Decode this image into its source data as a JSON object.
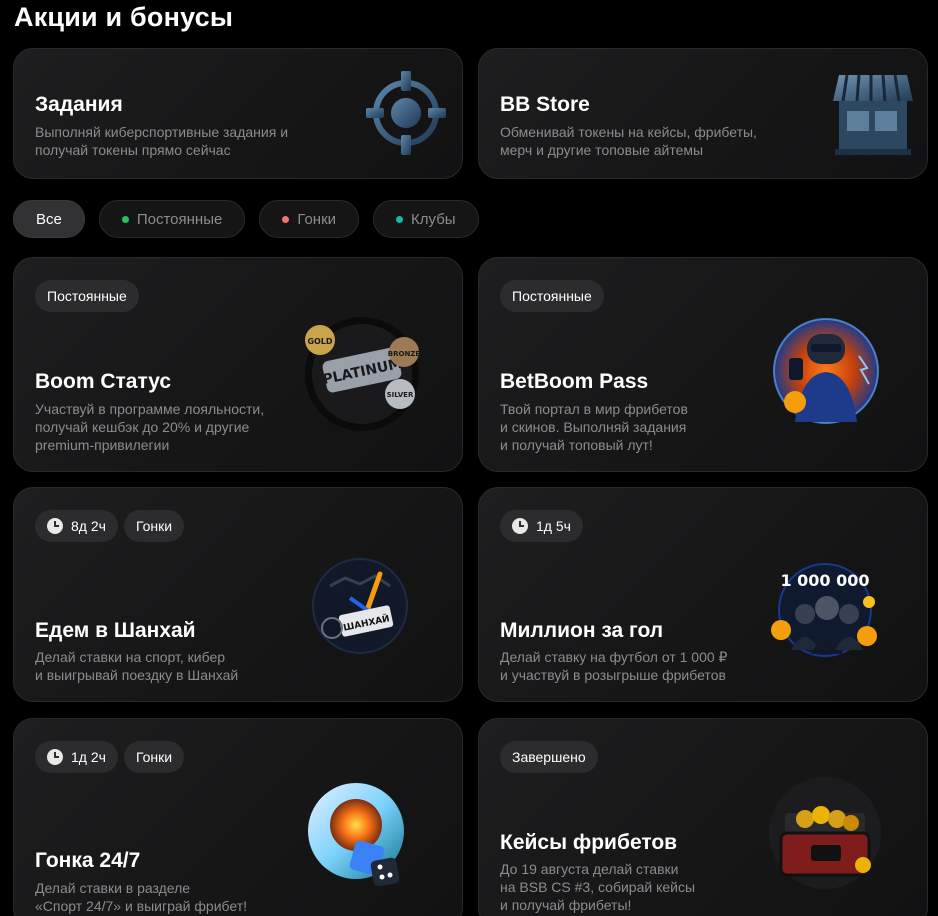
{
  "page": {
    "title": "Акции и бонусы"
  },
  "top_cards": [
    {
      "title": "Задания",
      "desc": "Выполняй киберспортивные задания и\nполучай токены прямо сейчас",
      "icon": "crosshair-icon"
    },
    {
      "title": "BB Store",
      "desc": "Обменивай токены на кейсы, фрибеты,\nмерч и другие топовые айтемы",
      "icon": "store-icon"
    }
  ],
  "filters": [
    {
      "label": "Все",
      "active": true
    },
    {
      "label": "Постоянные",
      "dot_color": "#22c55e"
    },
    {
      "label": "Гонки",
      "dot_color": "#f87171"
    },
    {
      "label": "Клубы",
      "dot_color": "#14b8a6"
    }
  ],
  "promos": [
    {
      "badges": [
        "Постоянные"
      ],
      "title": "Boom Статус",
      "desc": "Участвуй в программе лояльности,\nполучай кешбэк до 20% и другие\npremium-привилегии",
      "art": {
        "labels": [
          "GOLD",
          "PLATINUM",
          "BRONZE",
          "SILVER"
        ]
      }
    },
    {
      "badges": [
        "Постоянные"
      ],
      "title": "BetBoom Pass",
      "desc": "Твой портал в мир фрибетов\nи скинов. Выполняй задания\nи получай топовый лут!"
    },
    {
      "timer": "8д 2ч",
      "badges": [
        "Гонки"
      ],
      "title": "Едем в Шанхай",
      "desc": "Делай ставки на спорт, кибер\nи выигрывай поездку в Шанхай",
      "art": {
        "labels": [
          "ШАНХАЙ"
        ]
      }
    },
    {
      "timer": "1д 5ч",
      "badges": [],
      "title": "Миллион за гол",
      "desc": "Делай ставку на футбол от 1 000 ₽\nи участвуй в розыгрыше фрибетов",
      "art": {
        "labels": [
          "1 000 000"
        ]
      }
    },
    {
      "timer": "1д 2ч",
      "badges": [
        "Гонки"
      ],
      "title": "Гонка 24/7",
      "desc": "Делай ставки в разделе\n«Спорт 24/7» и выиграй фрибет!"
    },
    {
      "badges": [
        "Завершено"
      ],
      "title": "Кейсы фрибетов",
      "desc": "До 19 августа делай ставки\nна BSB CS #3, собирай кейсы\nи получай фрибеты!"
    }
  ]
}
